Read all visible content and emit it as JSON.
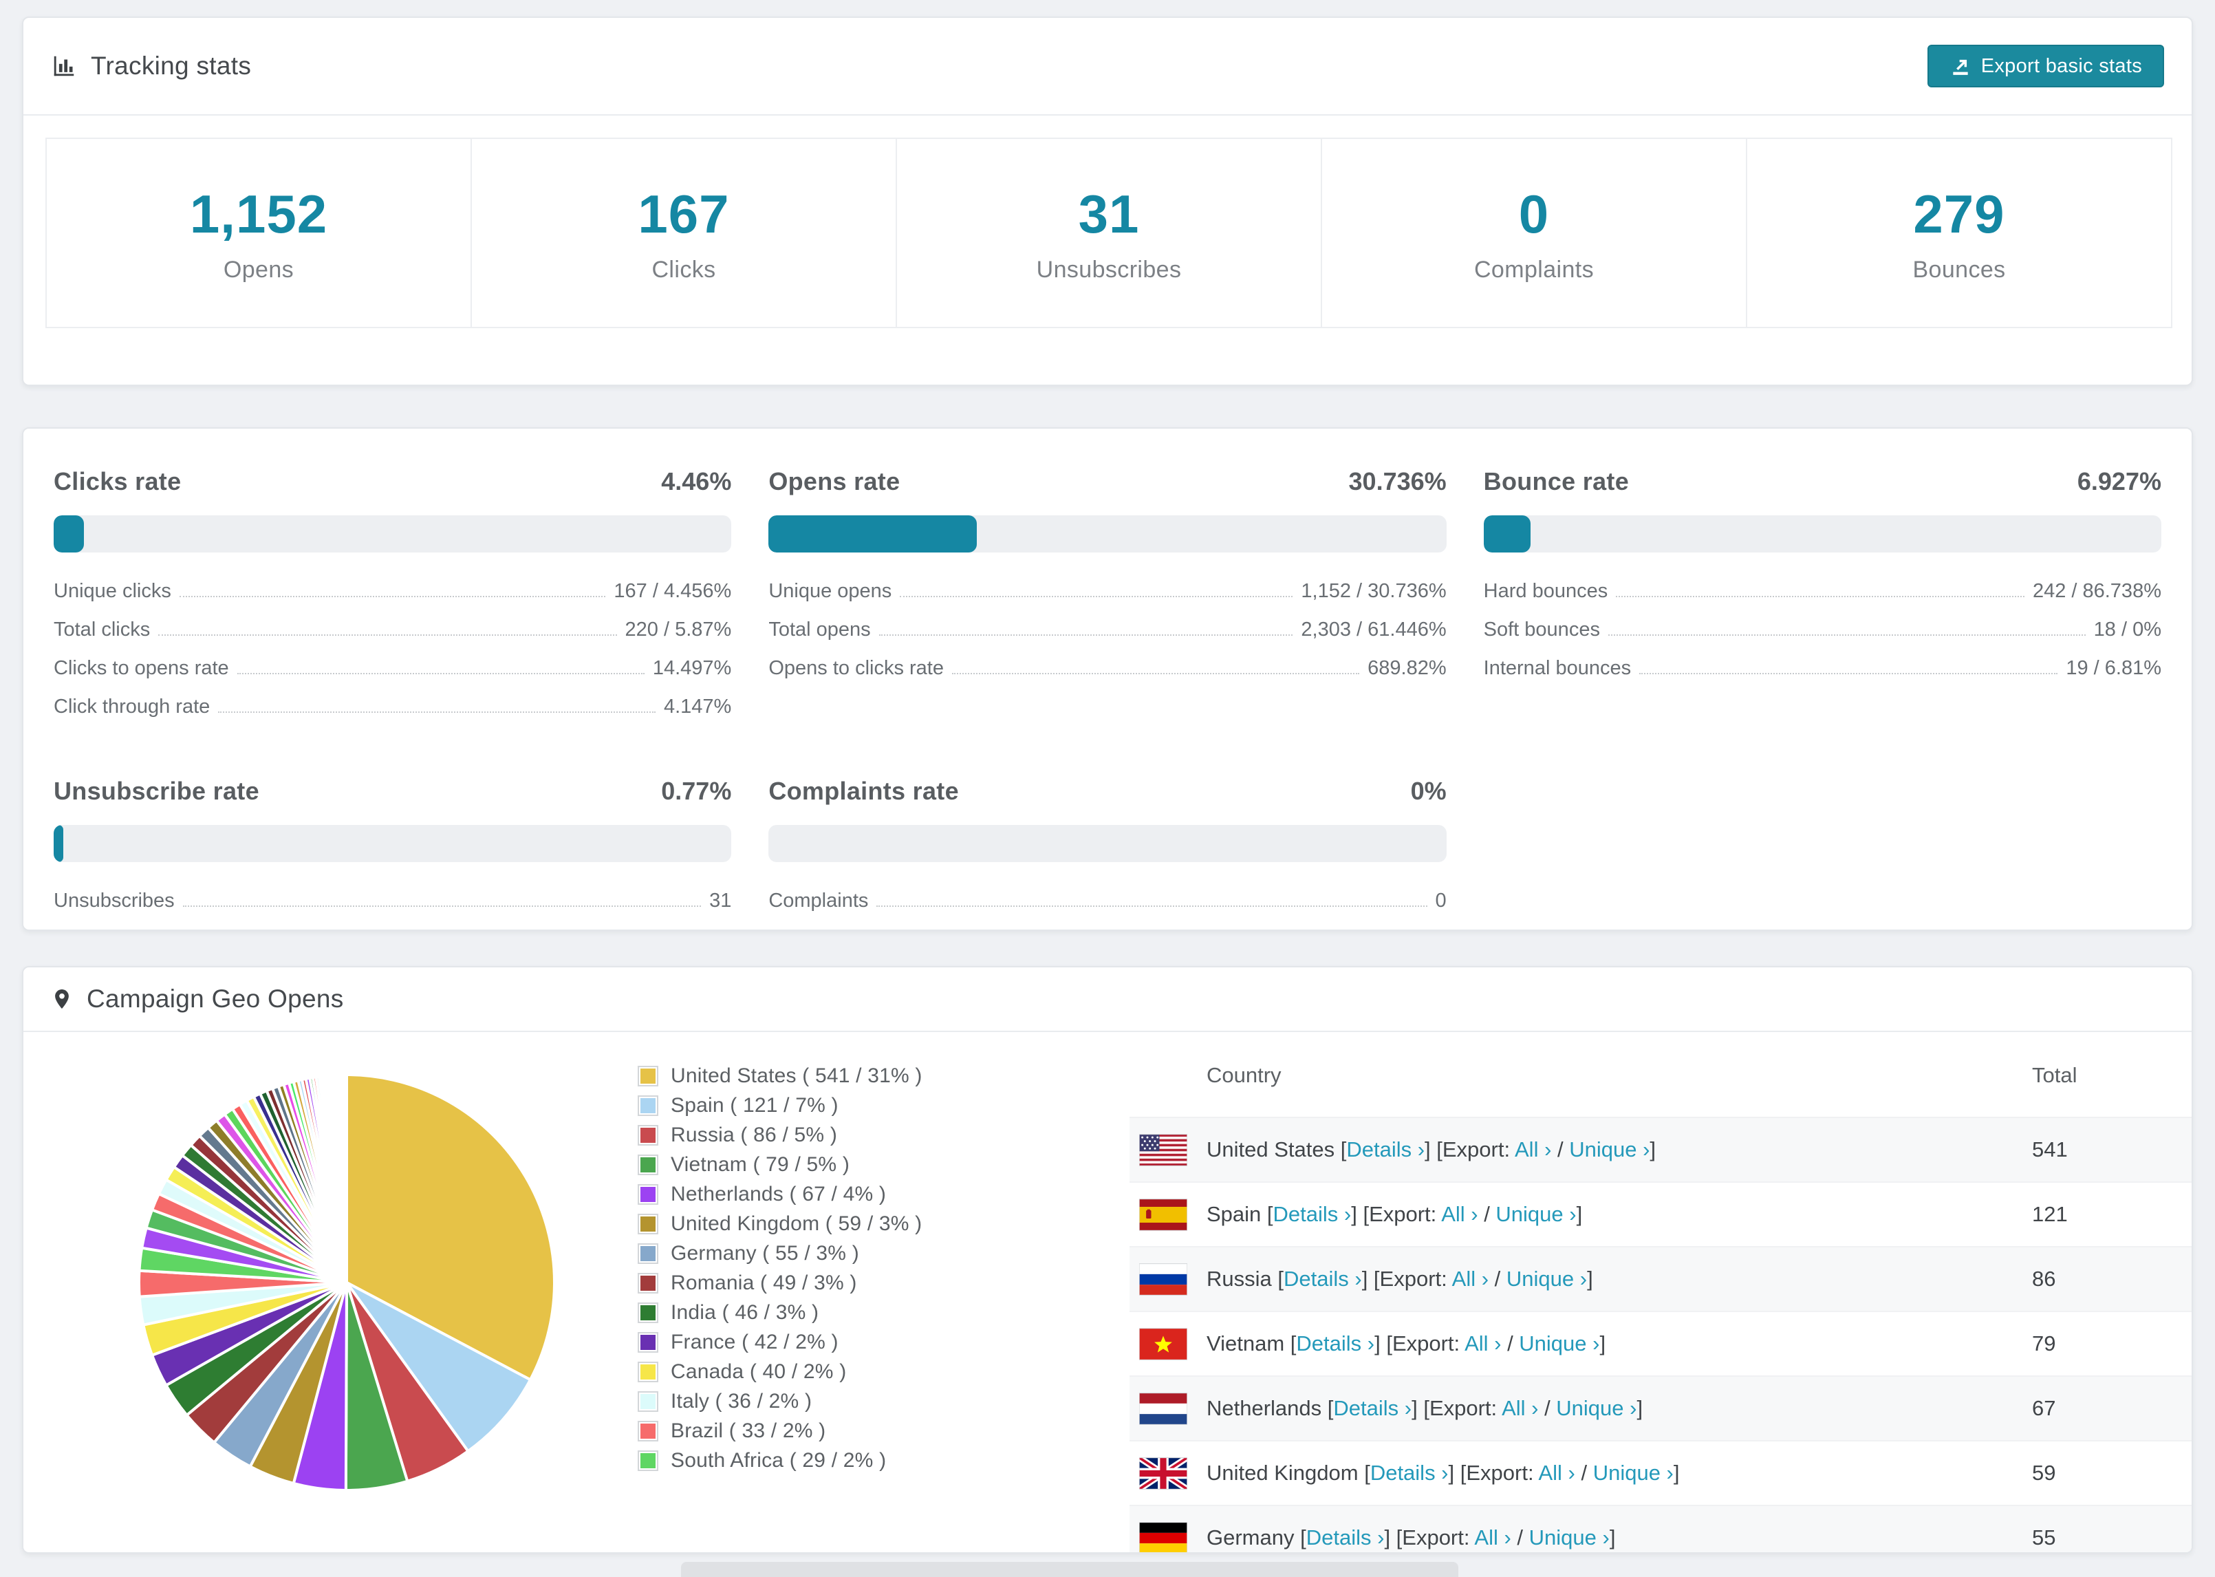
{
  "accent": "#1587a3",
  "link_color": "#2499ba",
  "tracking": {
    "title": "Tracking stats",
    "export_label": "Export basic stats",
    "stats": [
      {
        "value": "1,152",
        "label": "Opens"
      },
      {
        "value": "167",
        "label": "Clicks"
      },
      {
        "value": "31",
        "label": "Unsubscribes"
      },
      {
        "value": "0",
        "label": "Complaints"
      },
      {
        "value": "279",
        "label": "Bounces"
      }
    ]
  },
  "rates": {
    "clicks": {
      "title": "Clicks rate",
      "value": "4.46%",
      "percent": 4.46,
      "rows": [
        {
          "label": "Unique clicks",
          "value": "167 / 4.456%"
        },
        {
          "label": "Total clicks",
          "value": "220 / 5.87%"
        },
        {
          "label": "Clicks to opens rate",
          "value": "14.497%"
        },
        {
          "label": "Click through rate",
          "value": "4.147%"
        }
      ]
    },
    "opens": {
      "title": "Opens rate",
      "value": "30.736%",
      "percent": 30.736,
      "rows": [
        {
          "label": "Unique opens",
          "value": "1,152 / 30.736%"
        },
        {
          "label": "Total opens",
          "value": "2,303 / 61.446%"
        },
        {
          "label": "Opens to clicks rate",
          "value": "689.82%"
        }
      ]
    },
    "bounce": {
      "title": "Bounce rate",
      "value": "6.927%",
      "percent": 6.927,
      "rows": [
        {
          "label": "Hard bounces",
          "value": "242 / 86.738%"
        },
        {
          "label": "Soft bounces",
          "value": "18 / 0%"
        },
        {
          "label": "Internal bounces",
          "value": "19 / 6.81%"
        }
      ]
    },
    "unsubscribe": {
      "title": "Unsubscribe rate",
      "value": "0.77%",
      "percent": 0.77,
      "rows": [
        {
          "label": "Unsubscribes",
          "value": "31"
        }
      ]
    },
    "complaints": {
      "title": "Complaints rate",
      "value": "0%",
      "percent": 0,
      "rows": [
        {
          "label": "Complaints",
          "value": "0"
        }
      ]
    }
  },
  "geo": {
    "title": "Campaign Geo Opens",
    "table": {
      "columns": [
        "Country",
        "Total"
      ],
      "details_label": "Details ›",
      "export_prefix": "[Export:",
      "all_label": "All ›",
      "unique_label": "Unique ›",
      "rows": [
        {
          "country": "United States",
          "flag": "us",
          "total": "541"
        },
        {
          "country": "Spain",
          "flag": "es",
          "total": "121"
        },
        {
          "country": "Russia",
          "flag": "ru",
          "total": "86"
        },
        {
          "country": "Vietnam",
          "flag": "vn",
          "total": "79"
        },
        {
          "country": "Netherlands",
          "flag": "nl",
          "total": "67"
        },
        {
          "country": "United Kingdom",
          "flag": "gb",
          "total": "59"
        },
        {
          "country": "Germany",
          "flag": "de",
          "total": "55"
        }
      ]
    }
  },
  "chart_data": {
    "type": "pie",
    "title": "Campaign Geo Opens",
    "unit": "opens",
    "legend_position": "right",
    "start_angle_deg": 0,
    "direction": "clockwise",
    "labels": [
      "United States",
      "Spain",
      "Russia",
      "Vietnam",
      "Netherlands",
      "United Kingdom",
      "Germany",
      "Romania",
      "India",
      "France",
      "Canada",
      "Italy",
      "Brazil",
      "South Africa"
    ],
    "values": [
      541,
      121,
      86,
      79,
      67,
      59,
      55,
      49,
      46,
      42,
      40,
      36,
      33,
      29
    ],
    "percents": [
      "31%",
      "7%",
      "5%",
      "5%",
      "4%",
      "3%",
      "3%",
      "3%",
      "3%",
      "2%",
      "2%",
      "2%",
      "2%",
      "2%"
    ],
    "colors": [
      "#E6C247",
      "#ABD5F2",
      "#C94B4F",
      "#4BA64F",
      "#9C42F2",
      "#B4942F",
      "#86A8CB",
      "#A23C3C",
      "#2E7D32",
      "#6930B2",
      "#F6E649",
      "#DCFBFB",
      "#F66B6B",
      "#5FD663"
    ],
    "other_slices": {
      "note": "unlabeled long tail of small countries",
      "values": [
        26,
        24,
        22,
        20,
        19,
        18,
        17,
        16,
        15,
        14,
        13,
        12,
        11,
        10,
        10,
        9,
        9,
        8,
        8,
        7,
        7,
        6,
        6,
        5,
        5,
        5,
        4,
        4,
        4,
        3,
        3,
        3,
        3,
        2,
        2,
        2,
        2,
        2,
        2,
        1,
        1,
        1,
        1,
        1,
        1,
        1,
        1,
        1,
        1,
        1
      ],
      "palette": [
        "#A44BF2",
        "#54BC60",
        "#F66B6B",
        "#DFFBFB",
        "#F5EE55",
        "#5B2FA0",
        "#2F7A33",
        "#96353A",
        "#64798E",
        "#8E7D2A",
        "#DD55E8",
        "#5CD65C",
        "#FA6060",
        "#E8FFFF",
        "#F7F060",
        "#3A2F8E",
        "#20612F",
        "#7E2F2F",
        "#5E7488",
        "#907E22",
        "#E84CE8",
        "#4CE86A",
        "#D4A93C",
        "#A9D7F2",
        "#E05050"
      ]
    }
  }
}
